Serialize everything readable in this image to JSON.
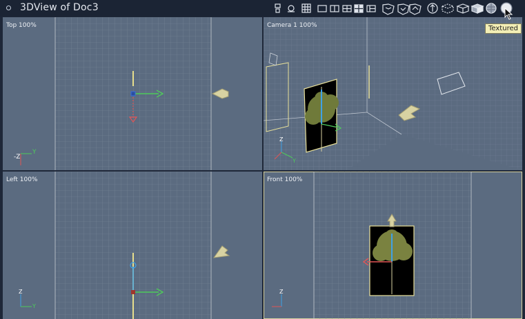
{
  "window": {
    "title": "3DView of Doc3"
  },
  "toolbar": {
    "icons": [
      "camera-icon",
      "walk-icon",
      "grid-icon",
      "layout-single-icon",
      "layout-two-icon",
      "layout-three-icon",
      "layout-four-icon",
      "layout-alt-icon",
      "view-cube-a-icon",
      "view-cube-b-icon",
      "view-cube-c-icon",
      "navigate-icon",
      "box-icon",
      "wire-box-icon",
      "shaded-box-icon",
      "sphere-shaded-icon",
      "sphere-textured-icon"
    ],
    "tooltip": "Textured"
  },
  "viewports": {
    "top": {
      "label": "Top 100%",
      "axes": {
        "x": "Y",
        "y": "-Z"
      }
    },
    "camera": {
      "label": "Camera 1 100%",
      "axes": {
        "x": "Y",
        "y": "Z"
      }
    },
    "left": {
      "label": "Left 100%",
      "axes": {
        "x": "Y",
        "y": "Z"
      }
    },
    "front": {
      "label": "Front 100%",
      "axes": {
        "x": "Y",
        "y": "Z"
      }
    }
  }
}
